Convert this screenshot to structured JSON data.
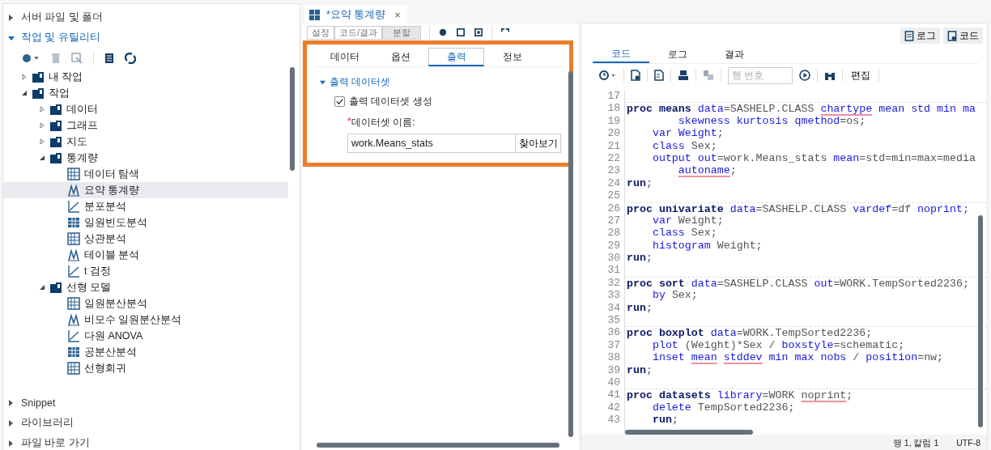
{
  "sidebar": {
    "sections": [
      {
        "label": "서버 파일 및 폴더",
        "expanded": false
      },
      {
        "label": "작업 및 유틸리티",
        "expanded": true,
        "tree": [
          {
            "label": "내 작업",
            "expanded": false,
            "selected": false
          },
          {
            "label": "작업",
            "expanded": true,
            "selected": false,
            "children": [
              {
                "label": "데이터",
                "expanded": false,
                "selected": false
              },
              {
                "label": "그래프",
                "expanded": false,
                "selected": false
              },
              {
                "label": "지도",
                "expanded": false,
                "selected": false
              },
              {
                "label": "통계량",
                "expanded": true,
                "selected": false,
                "children": [
                  {
                    "label": "데이터 탐색",
                    "selected": false
                  },
                  {
                    "label": "요약 통계량",
                    "selected": true
                  },
                  {
                    "label": "분포분석",
                    "selected": false
                  },
                  {
                    "label": "일원빈도분석",
                    "selected": false
                  },
                  {
                    "label": "상관분석",
                    "selected": false
                  },
                  {
                    "label": "테이블 분석",
                    "selected": false
                  },
                  {
                    "label": "t 검정",
                    "selected": false
                  }
                ]
              },
              {
                "label": "선형 모델",
                "expanded": true,
                "selected": false,
                "children": [
                  {
                    "label": "일원분산분석",
                    "selected": false
                  },
                  {
                    "label": "비모수 일원분산분석",
                    "selected": false
                  },
                  {
                    "label": "다원 ANOVA",
                    "selected": false
                  },
                  {
                    "label": "공분산분석",
                    "selected": false
                  },
                  {
                    "label": "선형회귀",
                    "selected": false
                  }
                ]
              }
            ]
          }
        ]
      },
      {
        "label": "Snippet",
        "expanded": false
      },
      {
        "label": "라이브러리",
        "expanded": false
      },
      {
        "label": "파일 바로 가기",
        "expanded": false
      }
    ]
  },
  "task_tab": {
    "title": "*요약 통계량",
    "close": "×"
  },
  "task_modes": [
    {
      "label": "설정",
      "selected": false
    },
    {
      "label": "코드/결과",
      "selected": false
    },
    {
      "label": "분할",
      "selected": true
    }
  ],
  "options_tabs": [
    {
      "label": "데이터",
      "selected": false
    },
    {
      "label": "옵션",
      "selected": false
    },
    {
      "label": "출력",
      "selected": true
    },
    {
      "label": "정보",
      "selected": false
    }
  ],
  "output_section": {
    "title": "출력 데이터셋",
    "expanded": true,
    "checkbox": {
      "label": "출력 데이터셋 생성",
      "checked": true
    },
    "name_field": {
      "asterisk": "*",
      "label": "데이터셋 이름:",
      "value": "work.Means_stats",
      "browse": "찾아보기"
    }
  },
  "view_buttons": [
    {
      "label": "로그"
    },
    {
      "label": "코드"
    }
  ],
  "code_tabs": [
    {
      "label": "코드",
      "selected": true
    },
    {
      "label": "로그",
      "selected": false
    },
    {
      "label": "결과",
      "selected": false
    }
  ],
  "code_toolbar": {
    "line_field": {
      "placeholder": "행 번호"
    },
    "edit": "편집"
  },
  "code_lines": [
    {
      "n": "17",
      "divider": false
    },
    {
      "n": "18",
      "divider": true,
      "tokens": [
        {
          "kind": "keyword",
          "text": "proc means "
        },
        {
          "kind": "option",
          "text": "data"
        },
        {
          "kind": "plain",
          "text": "=SASHELP.CLASS "
        },
        {
          "kind": "option",
          "text": "chartype",
          "flagged": true
        },
        {
          "kind": "option",
          "text": " mean std min ma"
        }
      ]
    },
    {
      "n": "19",
      "divider": false,
      "tokens": [
        {
          "kind": "option",
          "text": "        skewness kurtosis qmethod"
        },
        {
          "kind": "plain",
          "text": "=os;"
        }
      ]
    },
    {
      "n": "20",
      "divider": false,
      "tokens": [
        {
          "kind": "option",
          "text": "    var Weight"
        },
        {
          "kind": "plain",
          "text": ";"
        }
      ]
    },
    {
      "n": "21",
      "divider": false,
      "tokens": [
        {
          "kind": "option",
          "text": "    class"
        },
        {
          "kind": "plain",
          "text": " Sex;"
        }
      ]
    },
    {
      "n": "22",
      "divider": false,
      "tokens": [
        {
          "kind": "option",
          "text": "    output out"
        },
        {
          "kind": "plain",
          "text": "=work.Means_stats "
        },
        {
          "kind": "option",
          "text": "mean"
        },
        {
          "kind": "plain",
          "text": "=std=min=max=media"
        }
      ]
    },
    {
      "n": "23",
      "divider": false,
      "tokens": [
        {
          "kind": "option",
          "text": "        autoname",
          "flagged": true
        },
        {
          "kind": "plain",
          "text": ";"
        }
      ]
    },
    {
      "n": "24",
      "divider": false,
      "tokens": [
        {
          "kind": "keyword",
          "text": "run"
        },
        {
          "kind": "plain",
          "text": ";"
        }
      ]
    },
    {
      "n": "25",
      "divider": false
    },
    {
      "n": "26",
      "divider": true,
      "tokens": [
        {
          "kind": "keyword",
          "text": "proc univariate "
        },
        {
          "kind": "option",
          "text": "data"
        },
        {
          "kind": "plain",
          "text": "=SASHELP.CLASS "
        },
        {
          "kind": "option",
          "text": "vardef"
        },
        {
          "kind": "plain",
          "text": "=df "
        },
        {
          "kind": "option",
          "text": "noprint"
        },
        {
          "kind": "plain",
          "text": ";"
        }
      ]
    },
    {
      "n": "27",
      "divider": false,
      "tokens": [
        {
          "kind": "option",
          "text": "    var"
        },
        {
          "kind": "plain",
          "text": " Weight;"
        }
      ]
    },
    {
      "n": "28",
      "divider": false,
      "tokens": [
        {
          "kind": "option",
          "text": "    class"
        },
        {
          "kind": "plain",
          "text": " Sex;"
        }
      ]
    },
    {
      "n": "29",
      "divider": false,
      "tokens": [
        {
          "kind": "option",
          "text": "    histogram"
        },
        {
          "kind": "plain",
          "text": " Weight;"
        }
      ]
    },
    {
      "n": "30",
      "divider": false,
      "tokens": [
        {
          "kind": "keyword",
          "text": "run"
        },
        {
          "kind": "plain",
          "text": ";"
        }
      ]
    },
    {
      "n": "31",
      "divider": false
    },
    {
      "n": "32",
      "divider": true,
      "tokens": [
        {
          "kind": "keyword",
          "text": "proc sort "
        },
        {
          "kind": "option",
          "text": "data"
        },
        {
          "kind": "plain",
          "text": "=SASHELP.CLASS "
        },
        {
          "kind": "option",
          "text": "out"
        },
        {
          "kind": "plain",
          "text": "=WORK.TempSorted2236;"
        }
      ]
    },
    {
      "n": "33",
      "divider": false,
      "tokens": [
        {
          "kind": "option",
          "text": "    by"
        },
        {
          "kind": "plain",
          "text": " Sex;"
        }
      ]
    },
    {
      "n": "34",
      "divider": false,
      "tokens": [
        {
          "kind": "keyword",
          "text": "run"
        },
        {
          "kind": "plain",
          "text": ";"
        }
      ]
    },
    {
      "n": "35",
      "divider": false
    },
    {
      "n": "36",
      "divider": true,
      "tokens": [
        {
          "kind": "keyword",
          "text": "proc boxplot "
        },
        {
          "kind": "option",
          "text": "data"
        },
        {
          "kind": "plain",
          "text": "=WORK.TempSorted2236;"
        }
      ]
    },
    {
      "n": "37",
      "divider": false,
      "tokens": [
        {
          "kind": "option",
          "text": "    plot"
        },
        {
          "kind": "plain",
          "text": " (Weight)*Sex / "
        },
        {
          "kind": "option",
          "text": "boxstyle"
        },
        {
          "kind": "plain",
          "text": "=schematic;"
        }
      ]
    },
    {
      "n": "38",
      "divider": false,
      "tokens": [
        {
          "kind": "option",
          "text": "    inset "
        },
        {
          "kind": "option",
          "text": "mean",
          "flagged": true
        },
        {
          "kind": "option",
          "text": " stddev",
          "flagged": true
        },
        {
          "kind": "option",
          "text": " min max nobs"
        },
        {
          "kind": "plain",
          "text": " / "
        },
        {
          "kind": "option",
          "text": "position"
        },
        {
          "kind": "plain",
          "text": "=nw;"
        }
      ]
    },
    {
      "n": "39",
      "divider": false,
      "tokens": [
        {
          "kind": "keyword",
          "text": "run"
        },
        {
          "kind": "plain",
          "text": ";"
        }
      ]
    },
    {
      "n": "40",
      "divider": false
    },
    {
      "n": "41",
      "divider": true,
      "tokens": [
        {
          "kind": "keyword",
          "text": "proc datasets "
        },
        {
          "kind": "option",
          "text": "library"
        },
        {
          "kind": "plain",
          "text": "=WORK "
        },
        {
          "kind": "plain",
          "text": "noprint",
          "flagged": true
        },
        {
          "kind": "plain",
          "text": ";"
        }
      ]
    },
    {
      "n": "42",
      "divider": false,
      "tokens": [
        {
          "kind": "option",
          "text": "    delete"
        },
        {
          "kind": "plain",
          "text": " TempSorted2236;"
        }
      ]
    },
    {
      "n": "43",
      "divider": false,
      "tokens": [
        {
          "kind": "keyword",
          "text": "    run"
        },
        {
          "kind": "plain",
          "text": ";"
        }
      ]
    }
  ],
  "status_bar": {
    "position": "행 1, 칼럼 1",
    "encoding": "UTF-8"
  }
}
